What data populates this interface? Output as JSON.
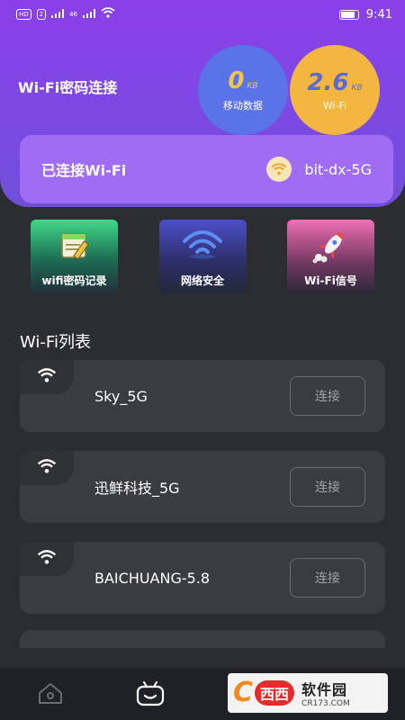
{
  "status_bar": {
    "left_badges": [
      "HD",
      "2"
    ],
    "left_signal": "46",
    "time": "9:41"
  },
  "header": {
    "title": "Wi-Fi密码连接",
    "mobile_data": {
      "value": "0",
      "unit": "KB",
      "label": "移动数据"
    },
    "wifi_data": {
      "value": "2.6",
      "unit": "KB",
      "label": "Wi-Fi"
    }
  },
  "connected": {
    "label": "已连接Wi-Fi",
    "ssid": "bit-dx-5G"
  },
  "tiles": [
    {
      "label": "wifi密码记录",
      "icon": "notebook-pencil-icon"
    },
    {
      "label": "网络安全",
      "icon": "wifi-icon"
    },
    {
      "label": "Wi-Fi信号",
      "icon": "rocket-icon"
    }
  ],
  "wifi_list": {
    "title": "Wi-Fi列表",
    "items": [
      {
        "name": "Sky_5G",
        "button": "连接"
      },
      {
        "name": "迅鲜科技_5G",
        "button": "连接"
      },
      {
        "name": "BAICHUANG-5.8",
        "button": "连接"
      }
    ]
  },
  "bottom_nav": {
    "items": [
      {
        "icon": "home-icon"
      },
      {
        "icon": "tv-robot-icon"
      }
    ]
  },
  "watermark": {
    "logo_letter": "C",
    "brand": "西西",
    "name": "软件园",
    "url": "CR173.COM"
  },
  "colors": {
    "hero": "#8b3fe8",
    "connected_card": "#9f6cf3",
    "mobile_bubble": "#5a73e8",
    "wifi_bubble": "#f3b640",
    "background": "#2b2d33"
  }
}
